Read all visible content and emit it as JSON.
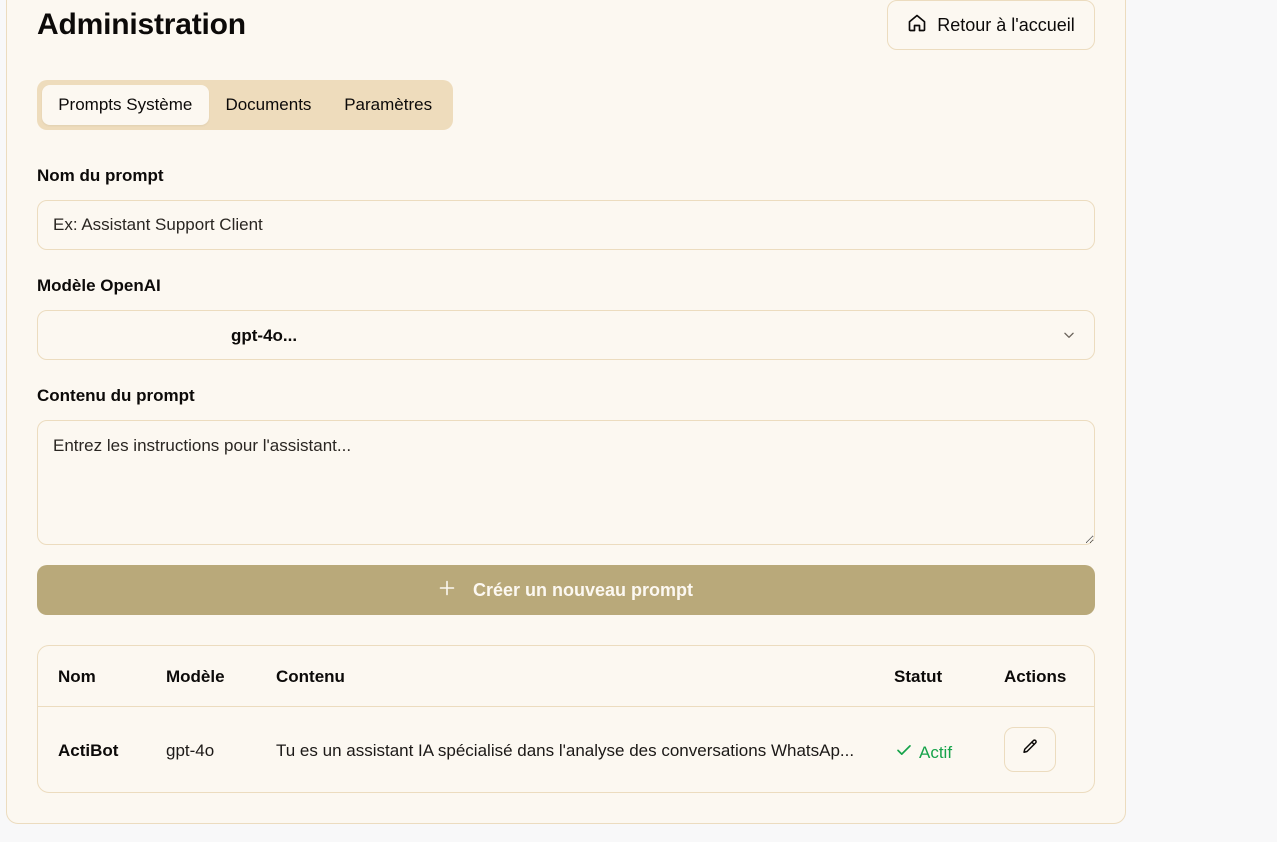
{
  "page": {
    "title": "Administration"
  },
  "header": {
    "home_button_label": "Retour à l'accueil"
  },
  "tabs": [
    {
      "label": "Prompts Système",
      "active": true
    },
    {
      "label": "Documents",
      "active": false
    },
    {
      "label": "Paramètres",
      "active": false
    }
  ],
  "form": {
    "name_label": "Nom du prompt",
    "name_placeholder": "Ex: Assistant Support Client",
    "name_value": "",
    "model_label": "Modèle OpenAI",
    "model_selected": "gpt-4o...",
    "content_label": "Contenu du prompt",
    "content_placeholder": "Entrez les instructions pour l'assistant...",
    "content_value": "",
    "create_button_label": "Créer un nouveau prompt"
  },
  "table": {
    "headers": [
      "Nom",
      "Modèle",
      "Contenu",
      "Statut",
      "Actions"
    ],
    "rows": [
      {
        "name": "ActiBot",
        "model": "gpt-4o",
        "content": "Tu es un assistant IA spécialisé dans l'analyse des conversations WhatsAp...",
        "status": "Actif"
      }
    ]
  },
  "colors": {
    "accent": "#b9a97a",
    "tabs_background": "#eedcbc",
    "card_background": "#fcf8f1",
    "border": "#ecdcbf",
    "status_active": "#16a34a"
  },
  "icons": {
    "home": "home-icon",
    "chevron": "chevron-down-icon",
    "plus": "plus-icon",
    "check": "check-icon",
    "edit": "pencil-icon"
  }
}
